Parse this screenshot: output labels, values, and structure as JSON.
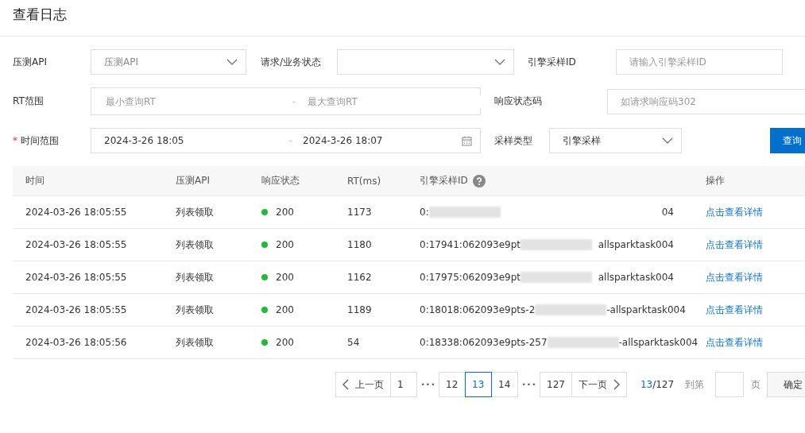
{
  "title": "查看日志",
  "filters": {
    "api": {
      "label": "压测API",
      "placeholder": "压测API"
    },
    "status": {
      "label": "请求/业务状态"
    },
    "sample_id": {
      "label": "引擎采样ID",
      "placeholder": "请输入引擎采样ID"
    },
    "rt": {
      "label": "RT范围",
      "min_placeholder": "最小查询RT",
      "separator": "-",
      "max_placeholder": "最大查询RT"
    },
    "code": {
      "label": "响应状态码",
      "placeholder": "如请求响应码302"
    },
    "time": {
      "label": "时间范围",
      "required_mark": "*",
      "start": "2024-3-26 18:05",
      "separator": "-",
      "end": "2024-3-26 18:07"
    },
    "sample_type": {
      "label": "采样类型",
      "value": "引擎采样"
    },
    "query_button": "查询"
  },
  "table": {
    "columns": [
      "时间",
      "压测API",
      "响应状态",
      "RT(ms)",
      "引擎采样ID",
      "操作"
    ],
    "rows": [
      {
        "time": "2024-03-26 18:05:55",
        "api": "列表领取",
        "status": "200",
        "color": "#1dbd3a",
        "rt": "1173",
        "id_start": "0:",
        "id_end": "04",
        "action": "点击查看详情"
      },
      {
        "time": "2024-03-26 18:05:55",
        "api": "列表领取",
        "status": "200",
        "color": "#1dbd3a",
        "rt": "1180",
        "id_start": "0:17941:062093e9pt",
        "id_end": "allsparktask004",
        "action": "点击查看详情"
      },
      {
        "time": "2024-03-26 18:05:55",
        "api": "列表领取",
        "status": "200",
        "color": "#1dbd3a",
        "rt": "1162",
        "id_start": "0:17975:062093e9pt",
        "id_end": "allsparktask004",
        "action": "点击查看详情"
      },
      {
        "time": "2024-03-26 18:05:55",
        "api": "列表领取",
        "status": "200",
        "color": "#1dbd3a",
        "rt": "1189",
        "id_start": "0:18018:062093e9pts-2",
        "id_end": "-allsparktask004",
        "action": "点击查看详情"
      },
      {
        "time": "2024-03-26 18:05:56",
        "api": "列表领取",
        "status": "200",
        "color": "#1dbd3a",
        "rt": "54",
        "id_start": "0:18338:062093e9pts-257",
        "id_end": "-allsparktask004",
        "action": "点击查看详情"
      }
    ]
  },
  "pagination": {
    "prev": "上一页",
    "next": "下一页",
    "items": [
      {
        "kind": "page",
        "label": "1",
        "selected": false
      },
      {
        "kind": "ellipsis",
        "label": "•••"
      },
      {
        "kind": "page",
        "label": "12",
        "selected": false
      },
      {
        "kind": "page",
        "label": "13",
        "selected": true
      },
      {
        "kind": "page",
        "label": "14",
        "selected": false
      },
      {
        "kind": "ellipsis",
        "label": "•••"
      },
      {
        "kind": "page",
        "label": "127",
        "selected": false
      }
    ],
    "current": "13",
    "total": "/127",
    "goto_label": "到第",
    "page_unit": "页",
    "confirm": "确定"
  }
}
